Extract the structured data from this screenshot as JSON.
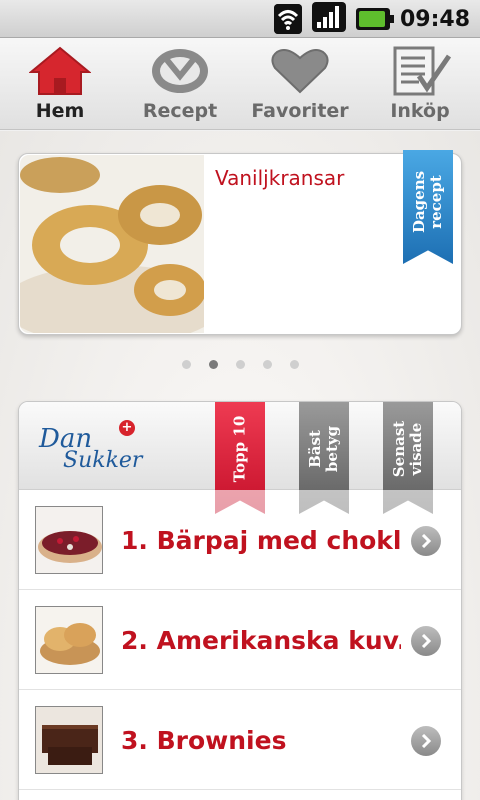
{
  "status_bar": {
    "time": "09:48",
    "icons": [
      "wifi-icon",
      "signal-icon",
      "battery-charging-icon"
    ]
  },
  "tabs": [
    {
      "label": "Hem",
      "icon": "home-icon",
      "active": true,
      "color": "#d6262e"
    },
    {
      "label": "Recept",
      "icon": "pretzel-icon",
      "active": false
    },
    {
      "label": "Favoriter",
      "icon": "heart-icon",
      "active": false
    },
    {
      "label": "Inköp",
      "icon": "checklist-icon",
      "active": false
    }
  ],
  "featured": {
    "title": "Vaniljkransar",
    "ribbon_line1": "Dagens",
    "ribbon_line2": "recept",
    "ribbon_color": "#2b8ad0",
    "image": "vanilla-wreath-cookies"
  },
  "pager": {
    "count": 5,
    "active_index": 1
  },
  "panel": {
    "logo_line1": "Dan",
    "logo_line2": "Sukker",
    "logo_cross": "+",
    "tabs": [
      {
        "line1": "Topp 10",
        "line2": "",
        "color": "#d6182f"
      },
      {
        "line1": "Bäst",
        "line2": "betyg",
        "color": "#6d6d6d"
      },
      {
        "line1": "Senast",
        "line2": "visade",
        "color": "#6d6d6d"
      }
    ],
    "items": [
      {
        "title": "1. Bärpaj med chokl...",
        "image": "berry-pie"
      },
      {
        "title": "2. Amerikanska kuv...",
        "image": "bread-rolls"
      },
      {
        "title": "3. Brownies",
        "image": "brownies"
      }
    ]
  },
  "colors": {
    "accent_red": "#c0121f"
  }
}
